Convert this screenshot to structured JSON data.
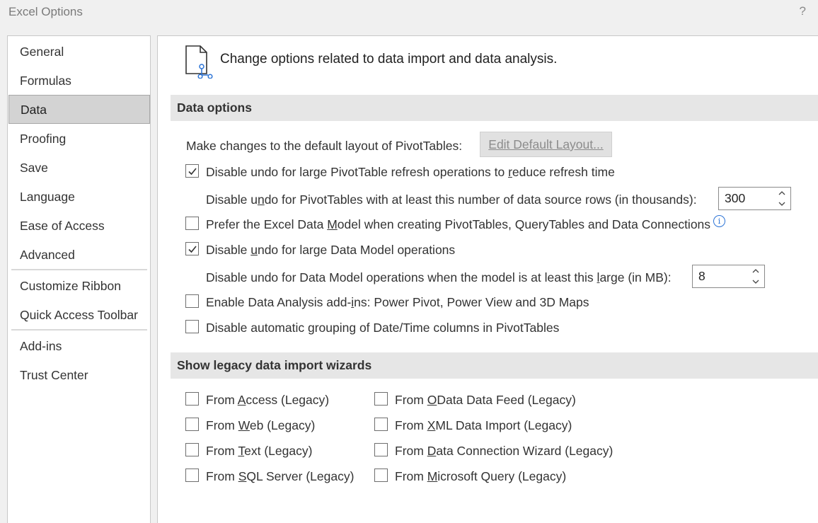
{
  "window": {
    "title": "Excel Options",
    "help": "?"
  },
  "nav": {
    "items": [
      {
        "label": "General"
      },
      {
        "label": "Formulas"
      },
      {
        "label": "Data",
        "selected": true
      },
      {
        "label": "Proofing"
      },
      {
        "label": "Save"
      },
      {
        "label": "Language"
      },
      {
        "label": "Ease of Access"
      },
      {
        "label": "Advanced"
      },
      {
        "label": "Customize Ribbon"
      },
      {
        "label": "Quick Access Toolbar"
      },
      {
        "label": "Add-ins"
      },
      {
        "label": "Trust Center"
      }
    ]
  },
  "header": {
    "text": "Change options related to data import and data analysis.",
    "icon": "document-data-icon"
  },
  "data_options": {
    "heading": "Data options",
    "pivot_layout_label": "Make changes to the default layout of PivotTables:",
    "edit_layout_button": "Edit Default Layout...",
    "disable_undo_pivot": {
      "pre": "Disable undo for large PivotTable refresh operations to ",
      "key": "r",
      "post": "educe refresh time",
      "checked": true
    },
    "pivot_rows": {
      "pre": "Disable u",
      "key": "n",
      "post": "do for PivotTables with at least this number of data source rows (in thousands):",
      "value": "300"
    },
    "prefer_data_model": {
      "pre": "Prefer the Excel Data ",
      "key": "M",
      "post": "odel when creating PivotTables, QueryTables and Data Connections",
      "checked": false
    },
    "disable_undo_model": {
      "pre": "Disable ",
      "key": "u",
      "post": "ndo for large Data Model operations",
      "checked": true
    },
    "model_size": {
      "pre": "Disable undo for Data Model operations when the model is at least this ",
      "key": "l",
      "post": "arge (in MB):",
      "value": "8"
    },
    "enable_addins": {
      "pre": "Enable Data Analysis add-",
      "key": "i",
      "post": "ns: Power Pivot, Power View and 3D Maps",
      "checked": false
    },
    "disable_grouping": {
      "pre": "Disable automatic ",
      "key": "g",
      "post": "rouping of Date/Time columns in PivotTables",
      "checked": false
    }
  },
  "legacy": {
    "heading": "Show legacy data import wizards",
    "left": [
      {
        "pre": "From ",
        "key": "A",
        "post": "ccess (Legacy)",
        "checked": false
      },
      {
        "pre": "From ",
        "key": "W",
        "post": "eb (Legacy)",
        "checked": false
      },
      {
        "pre": "From ",
        "key": "T",
        "post": "ext (Legacy)",
        "checked": false
      },
      {
        "pre": "From ",
        "key": "S",
        "post": "QL Server (Legacy)",
        "checked": false
      }
    ],
    "right": [
      {
        "pre": "From ",
        "key": "O",
        "post": "Data Data Feed (Legacy)",
        "checked": false
      },
      {
        "pre": "From ",
        "key": "X",
        "post": "ML Data Import (Legacy)",
        "checked": false
      },
      {
        "pre": "From ",
        "key": "D",
        "post": "ata Connection Wizard (Legacy)",
        "checked": false
      },
      {
        "pre": "From ",
        "key": "M",
        "post": "icrosoft Query (Legacy)",
        "checked": false
      }
    ]
  },
  "colors": {
    "accent": "#2b73d6",
    "section_bg": "#e6e6e6",
    "selected_bg": "#d3d3d3"
  }
}
